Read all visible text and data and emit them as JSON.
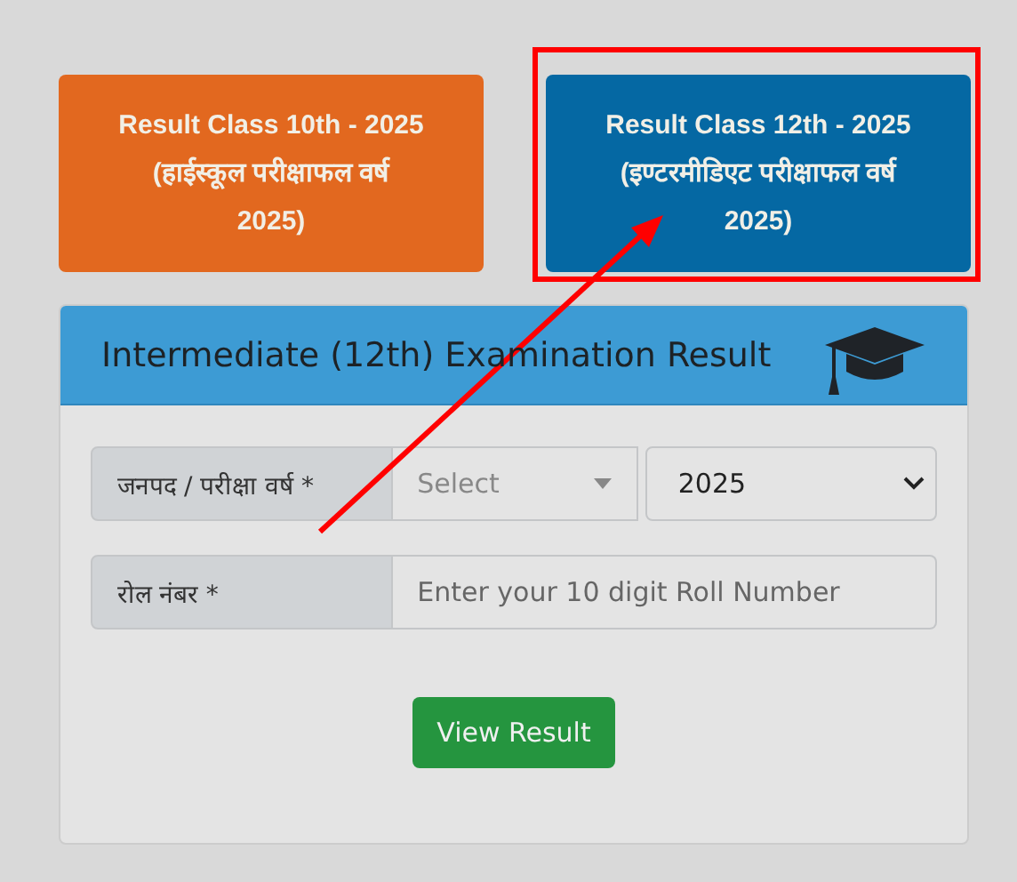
{
  "result_buttons": [
    {
      "label": "Result Class 10th - 2025 (हाईस्कूल परीक्षाफल वर्ष 2025)",
      "color": "#e2681f"
    },
    {
      "label": "Result Class 12th - 2025 (इण्टरमीडिएट परीक्षाफल वर्ष 2025)",
      "color": "#0568a3"
    }
  ],
  "card": {
    "title": "Intermediate (12th) Examination Result",
    "district_row": {
      "label": "जनपद / परीक्षा वर्ष *",
      "district_placeholder": "Select",
      "year_value": "2025"
    },
    "roll_row": {
      "label": "रोल नंबर *",
      "placeholder": "Enter your 10 digit Roll Number"
    },
    "submit": "View Result"
  },
  "annotations": {
    "highlight_box": true,
    "arrow": true
  }
}
